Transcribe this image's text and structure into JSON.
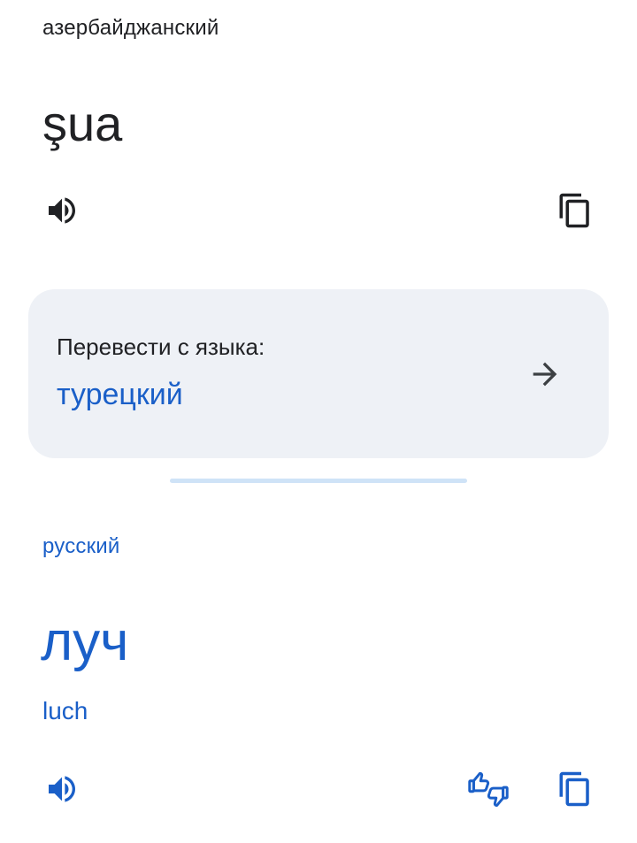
{
  "source": {
    "language": "азербайджанский",
    "text": "şua"
  },
  "detect_card": {
    "label": "Перевести с языка:",
    "language": "турецкий"
  },
  "target": {
    "language": "русский",
    "text": "луч",
    "transliteration": "luch"
  },
  "icons": {
    "source_speaker": "speaker-icon",
    "source_copy": "copy-icon",
    "detect_arrow": "arrow-right-icon",
    "target_speaker": "speaker-icon",
    "target_rate": "thumbs-up-down-icon",
    "target_copy": "copy-icon"
  },
  "colors": {
    "accent": "#1a5fc8",
    "card_bg": "#eef1f6",
    "text": "#202124",
    "divider": "#cfe3f7"
  }
}
